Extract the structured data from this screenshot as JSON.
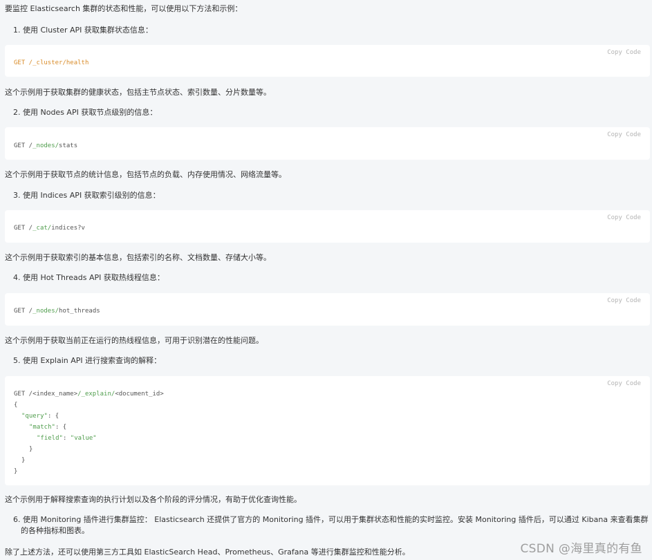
{
  "intro": "要监控 Elasticsearch 集群的状态和性能，可以使用以下方法和示例：",
  "copy_label": "Copy  Code",
  "items": [
    {
      "title": "1. 使用 Cluster API 获取集群状态信息：",
      "code": {
        "method": "GET",
        "path": " /_cluster/health"
      },
      "desc": "这个示例用于获取集群的健康状态，包括主节点状态、索引数量、分片数量等。"
    },
    {
      "title": "2. 使用 Nodes API 获取节点级别的信息：",
      "code": {
        "method": "GET",
        "prefix": " /",
        "path": "_nodes/",
        "suffix": "stats"
      },
      "desc": "这个示例用于获取节点的统计信息，包括节点的负载、内存使用情况、网络流量等。"
    },
    {
      "title": "3. 使用 Indices API 获取索引级别的信息：",
      "code": {
        "method": "GET",
        "prefix": " /",
        "path": "_cat/",
        "suffix": "indices?v"
      },
      "desc": "这个示例用于获取索引的基本信息，包括索引的名称、文档数量、存储大小等。"
    },
    {
      "title": "4. 使用 Hot Threads API 获取热线程信息：",
      "code": {
        "method": "GET",
        "prefix": " /",
        "path": "_nodes/",
        "suffix": "hot_threads"
      },
      "desc": "这个示例用于获取当前正在运行的热线程信息，可用于识别潜在的性能问题。"
    },
    {
      "title": "5. 使用 Explain API 进行搜索查询的解释：",
      "code": {
        "line1_a": "GET /<index_name>",
        "line1_b": "/_explain/",
        "line1_c": "<document_id>",
        "l2": "{",
        "l3_key": "\"query\"",
        "l3_rest": ": {",
        "l4_key": "\"match\"",
        "l4_rest": ": {",
        "l5_key": "\"field\"",
        "l5_mid": ": ",
        "l5_val": "\"value\"",
        "l6": "}",
        "l7": "}",
        "l8": "}"
      },
      "desc": "这个示例用于解释搜索查询的执行计划以及各个阶段的评分情况，有助于优化查询性能。"
    },
    {
      "title": "6. 使用 Monitoring 插件进行集群监控： Elasticsearch 还提供了官方的 Monitoring 插件，可以用于集群状态和性能的实时监控。安装 Monitoring 插件后，可以通过 Kibana 来查看集群的各种指标和图表。"
    }
  ],
  "outro": "除了上述方法，还可以使用第三方工具如 ElasticSearch Head、Prometheus、Grafana 等进行集群监控和性能分析。",
  "watermark": "CSDN @海里真的有鱼"
}
